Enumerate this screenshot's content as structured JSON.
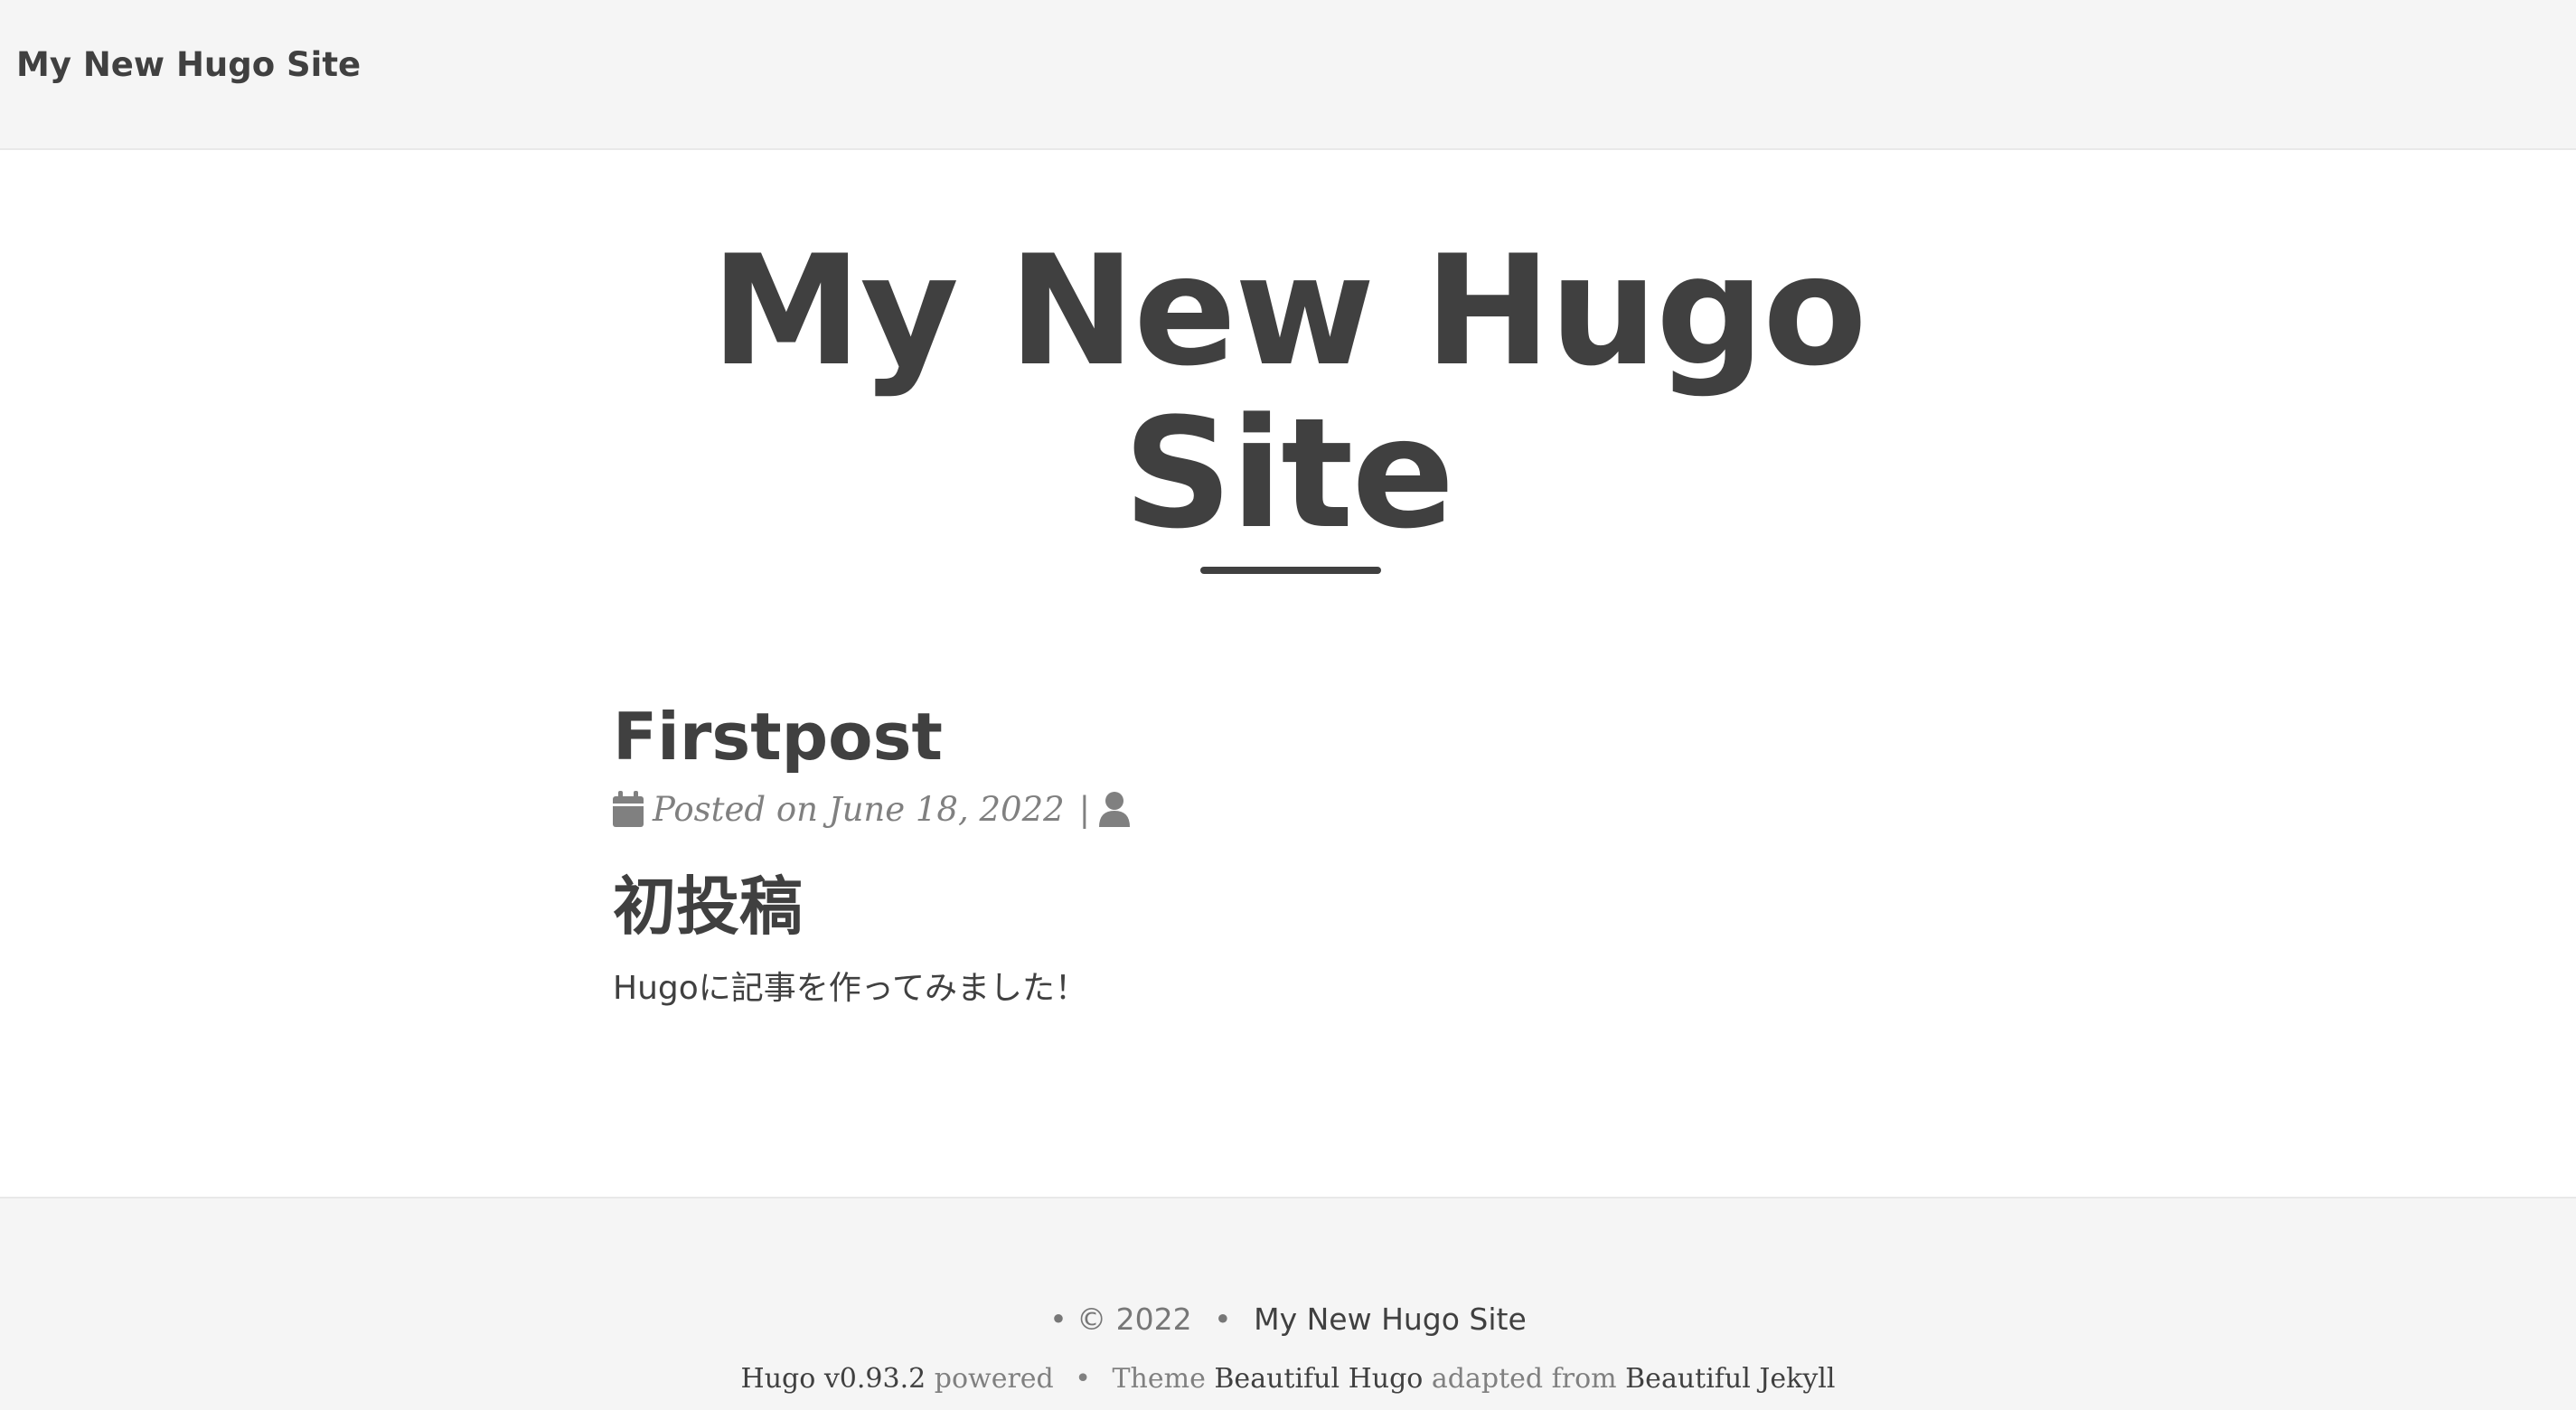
{
  "navbar": {
    "brand": "My New Hugo Site"
  },
  "hero": {
    "title": "My New Hugo Site"
  },
  "post": {
    "title": "Firstpost",
    "meta_posted": "Posted on June 18, 2022",
    "meta_separator": "|",
    "subtitle": "初投稿",
    "body": "Hugoに記事を作ってみました！"
  },
  "footer": {
    "copyright_prefix": "• © 2022",
    "bullet": "•",
    "site_link": "My New Hugo Site",
    "hugo_link": "Hugo v0.93.2",
    "powered_text": "powered",
    "theme_text": "Theme",
    "theme_link": "Beautiful Hugo",
    "adapted_text": "adapted from",
    "jekyll_link": "Beautiful Jekyll"
  },
  "colors": {
    "text": "#404040",
    "muted": "#808080",
    "navbar_bg": "#f5f5f5",
    "footer_bg": "#f5f5f5"
  },
  "icons": {
    "calendar": "calendar-icon",
    "user": "user-icon"
  }
}
